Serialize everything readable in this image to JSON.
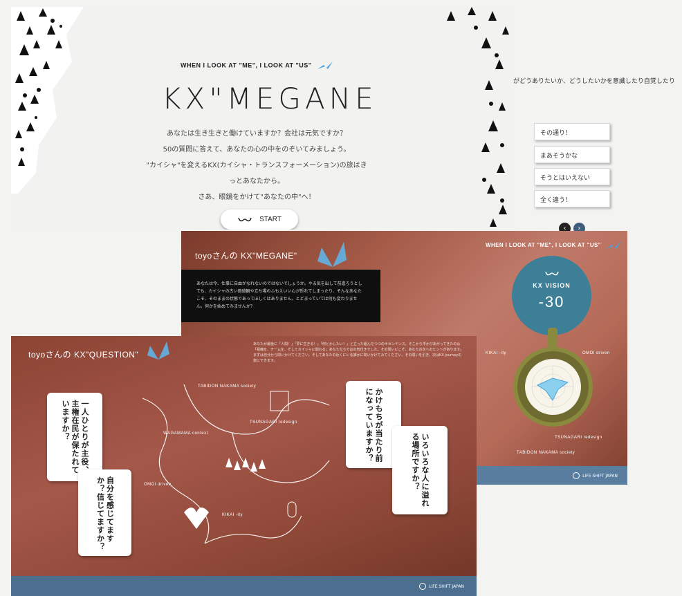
{
  "landing": {
    "tagline": "WHEN I LOOK AT \"ME\", I LOOK AT \"US\"",
    "logo": "KX\"MEGANE",
    "intro_lines": [
      "あなたは生き生きと働けていますか？会社は元気ですか？",
      "50の質問に答えて、あなたの心の中をのぞいてみましょう。",
      "\"カイシャ\"を変えるKX(カイシャ・トランスフォーメーション)の旅はき",
      "っとあなたから。",
      "さあ、眼鏡をかけて\"あなたの中\"へ！"
    ],
    "start_label": "START"
  },
  "answer_panel": {
    "question_text": "がどうありたいか、どうしたいかを意識したり自覚したり",
    "options": [
      "その通り！",
      "まあそうかな",
      "そうとはいえない",
      "全く違う！"
    ],
    "prev": "‹",
    "next": "›"
  },
  "result": {
    "title": "toyoさんの KX\"MEGANE\"",
    "message": "あなたは今、仕事に自由がなれないのではないでしょうか。やる気を出して前進ろうとしても、カイシャの古い価値観や立ち場のふもえいい心が折れてしまったり、そんなあなたこそ、そのままの状態であってほしくはありません。とどまっていては何も変わりません。何かを始めてみませんか？",
    "tagline": "WHEN I LOOK AT \"ME\", I LOOK AT \"US\"",
    "vision_label": "KX VISION",
    "vision_value": "-30",
    "labels": [
      "KIKAI -ity",
      "OMOI driven",
      "TSUNAGARI redesign",
      "TABIDON NAKAMA society"
    ],
    "footer": "LIFE SHIFT JAPAN"
  },
  "question": {
    "title": "toyoさんの KX\"QUESTION\"",
    "description": "あなたが最後に「人間！」「夢に生きる！」「何とかしたい！」と立った組んだつつのキセンテンス。そこから浮かびあがってきたのは「組織を、チームを、そしてカイシャに関わる」あなたならではの気付きでした。その問いにこそ、あなたの次へのヒントがあります。まずは自分から問いかけてください。そしてあなたの近くにいる誰かに問いかけてみてください。その問いを引き、次はKX journeyの旅にできます。",
    "cards": [
      "一人ひとりが主役、主権在民が保たれていますか？",
      "自分を感じてますか？信じてますか？",
      "かけもちが当たり前になっていますか？",
      "いろいろな人に溢れる場所ですか？"
    ],
    "map_labels": [
      "TABIDON NAKAMA society",
      "WAGAMAMA context",
      "TSUNAGARI redesign",
      "OMOI driven",
      "KIKAI -ity"
    ],
    "footer": "LIFE SHIFT JAPAN"
  },
  "colors": {
    "accent_blue": "#4aa3d8",
    "map_red": "#8d4433",
    "vision_teal": "#3d7f96"
  }
}
